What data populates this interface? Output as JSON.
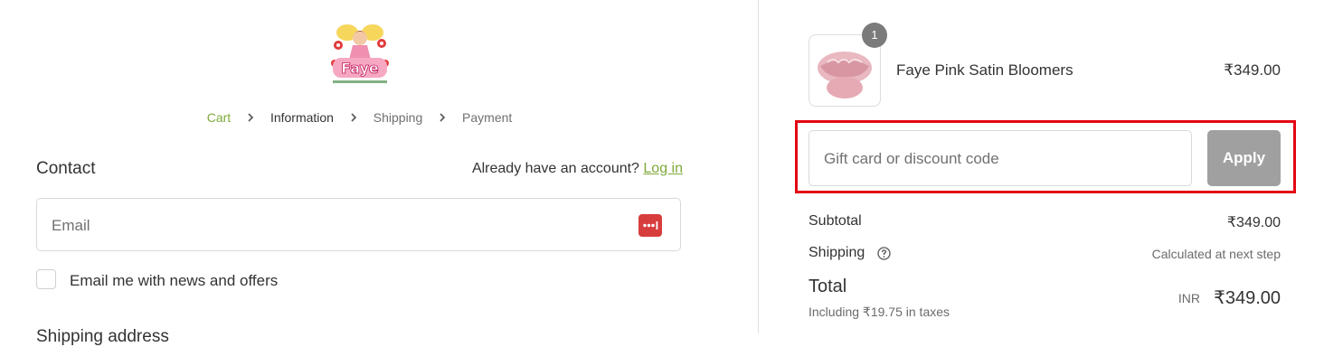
{
  "breadcrumb": [
    "Cart",
    "Information",
    "Shipping",
    "Payment"
  ],
  "contact": {
    "title": "Contact",
    "account_prompt": "Already have an account?",
    "login_label": "Log in",
    "email_placeholder": "Email",
    "newsletter_label": "Email me with news and offers"
  },
  "next_section_heading": "Shipping address",
  "order": {
    "quantity": "1",
    "product_name": "Faye Pink Satin Bloomers",
    "product_price": "₹349.00",
    "discount_placeholder": "Gift card or discount code",
    "apply_label": "Apply",
    "subtotal_label": "Subtotal",
    "subtotal_value": "₹349.00",
    "shipping_label": "Shipping",
    "shipping_value": "Calculated at next step",
    "total_label": "Total",
    "tax_note": "Including ₹19.75 in taxes",
    "currency": "INR",
    "total_value": "₹349.00"
  },
  "colors": {
    "accent": "#7fa93a",
    "highlight": "#e30613",
    "apply_button": "#a0a0a0",
    "password_manager_icon": "#d83d3d"
  },
  "icons": [
    "store-logo",
    "chevron-right-icon",
    "password-manager-icon",
    "help-circle-icon",
    "product-image"
  ]
}
